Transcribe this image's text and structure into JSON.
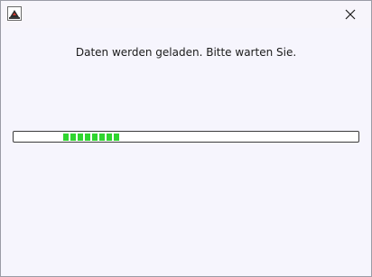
{
  "window": {
    "app_icon": "java-app-icon",
    "close_icon": "close-icon"
  },
  "dialog": {
    "message": "Daten werden geladen. Bitte warten Sie."
  },
  "progress": {
    "segments": 8,
    "indeterminate": true,
    "fill_color": "#2fd52f"
  }
}
